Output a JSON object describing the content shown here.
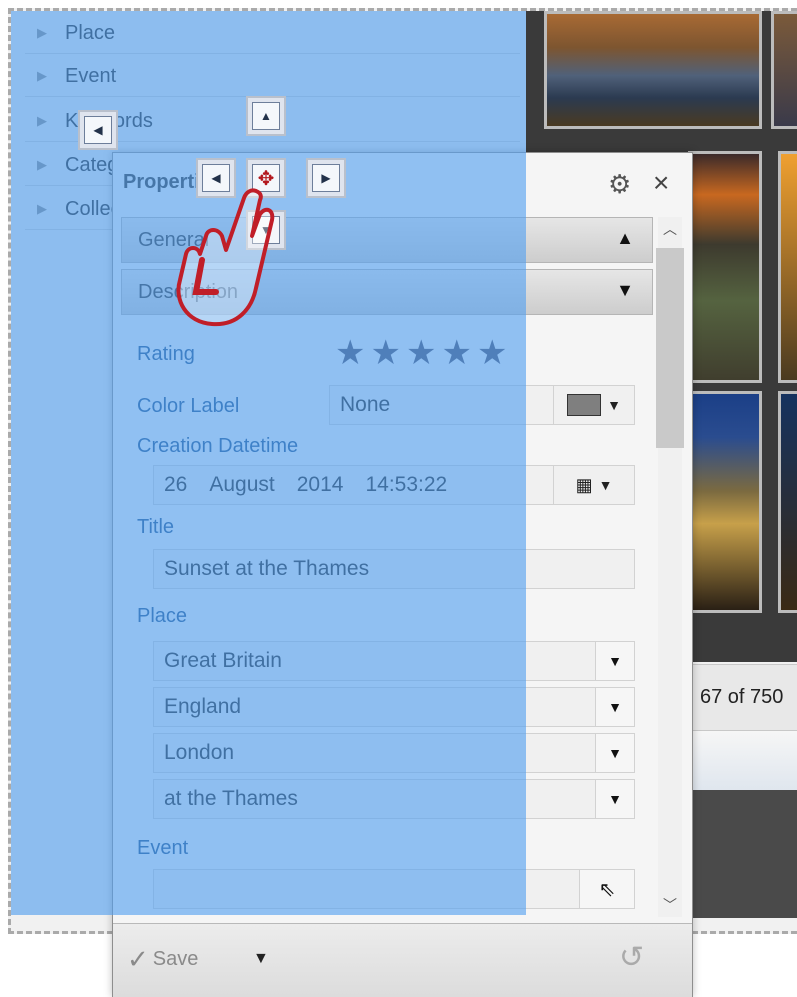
{
  "tree": {
    "items": [
      {
        "label": "Place"
      },
      {
        "label": "Event"
      },
      {
        "label": "Keywords"
      },
      {
        "label": "Categories"
      },
      {
        "label": "Collections"
      }
    ]
  },
  "status": {
    "count_text": "67 of 750"
  },
  "panel": {
    "title": "Properties",
    "gear_icon": "gear-icon",
    "close_label": "×",
    "sections": [
      {
        "label": "General",
        "state": "collapsed-up"
      },
      {
        "label": "Description",
        "state": "expanded"
      }
    ],
    "rating": {
      "label": "Rating",
      "value": 5,
      "max": 5
    },
    "color_label": {
      "label": "Color Label",
      "value": "None",
      "swatch": "#7f7f7f"
    },
    "creation": {
      "label": "Creation Datetime",
      "day": "26",
      "month": "August",
      "year": "2014",
      "time": "14:53:22"
    },
    "title_field": {
      "label": "Title",
      "value": "Sunset at the Thames"
    },
    "place": {
      "label": "Place",
      "country": "Great Britain",
      "state": "England",
      "city": "London",
      "location": "at the Thames"
    },
    "event": {
      "label": "Event",
      "value": ""
    },
    "footer": {
      "save_label": "Save"
    }
  },
  "colors": {
    "overlay": "#52a0f0",
    "label_blue": "#1f4f86",
    "star": "#4b4b63"
  }
}
